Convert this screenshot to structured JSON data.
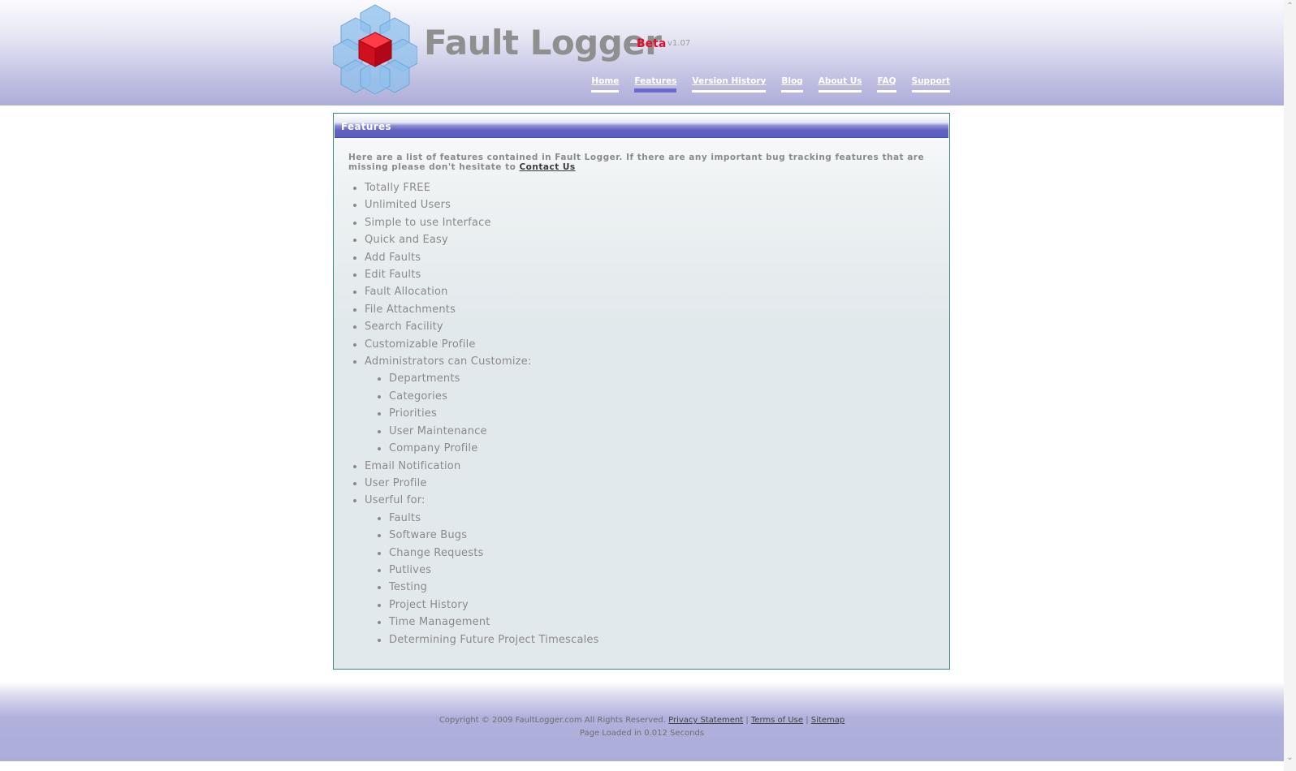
{
  "header": {
    "title": "Fault Logger",
    "beta": "Beta",
    "version": "v1.07",
    "nav": [
      "Home",
      "Features",
      "Version History",
      "Blog",
      "About Us",
      "FAQ",
      "Support"
    ],
    "active_nav": "Features"
  },
  "panel": {
    "title": "Features",
    "intro": "Here are a list of features contained in Fault Logger. If there are any important bug tracking features that are missing please don't hesitate to ",
    "intro_link": "Contact Us",
    "features": [
      {
        "label": "Totally FREE"
      },
      {
        "label": "Unlimited Users"
      },
      {
        "label": "Simple to use Interface"
      },
      {
        "label": "Quick and Easy"
      },
      {
        "label": "Add Faults"
      },
      {
        "label": "Edit Faults"
      },
      {
        "label": "Fault Allocation"
      },
      {
        "label": "File Attachments"
      },
      {
        "label": "Search Facility"
      },
      {
        "label": "Customizable Profile"
      },
      {
        "label": "Administrators can Customize:",
        "sub": [
          "Departments",
          "Categories",
          "Priorities",
          "User Maintenance",
          "Company Profile"
        ]
      },
      {
        "label": "Email Notification"
      },
      {
        "label": "User Profile"
      },
      {
        "label": "Userful for:",
        "sub": [
          "Faults",
          "Software Bugs",
          "Change Requests",
          "Putlives",
          "Testing",
          "Project History",
          "Time Management",
          "Determining Future Project Timescales"
        ]
      }
    ]
  },
  "footer": {
    "copyright": "Copyright © 2009 FaultLogger.com All Rights Reserved. ",
    "privacy": "Privacy Statement",
    "terms": "Terms of Use",
    "sitemap": "Sitemap",
    "separator": " | ",
    "load_time": "Page Loaded in 0.012 Seconds"
  },
  "colors": {
    "accent": "#5c5cbc",
    "beta": "#e0102a",
    "panel_border": "#3c8a86",
    "band": "#adadda"
  }
}
